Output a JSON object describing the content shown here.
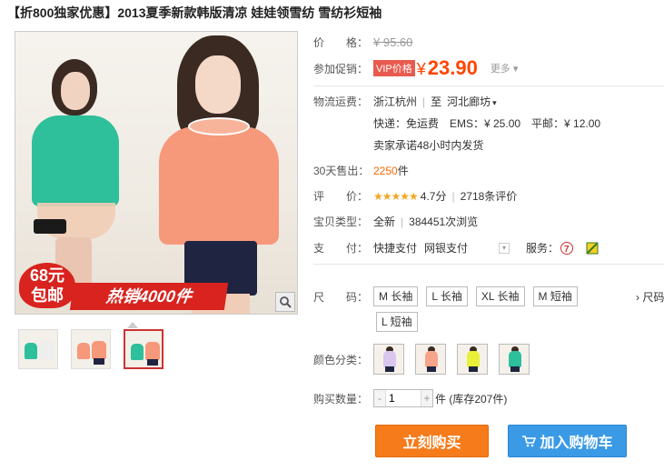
{
  "title": "【折800独家优惠】2013夏季新款韩版清凉 娃娃领雪纺 雪纺衫短袖",
  "image": {
    "badge_line1": "68元",
    "badge_line2": "包邮",
    "banner": "热销4000件",
    "zoom_icon": "magnifier-icon"
  },
  "price": {
    "label": "价　　格：",
    "original": "¥ 95.60"
  },
  "promo": {
    "label": "参加促销：",
    "tag": "VIP价格",
    "yen": "¥",
    "amount": "23.90",
    "more": "更多 ▾"
  },
  "shipping": {
    "label": "物流运费：",
    "from": "浙江杭州",
    "to_prefix": "至",
    "to": "河北廊坊",
    "line2": "快递：免运费　EMS：¥ 25.00　平邮：¥ 12.00",
    "line3": "卖家承诺48小时内发货"
  },
  "sales": {
    "label": "30天售出：",
    "count": "2250",
    "unit": "件"
  },
  "rating": {
    "label": "评　　价：",
    "stars": "★★★★★",
    "score": "4.7分",
    "reviews": "2718条评价"
  },
  "condition": {
    "label": "宝贝类型：",
    "value": "全新",
    "views": "384451次浏览"
  },
  "payment": {
    "label": "支　　付：",
    "method1": "快捷支付",
    "method2": "网银支付",
    "service_label": "服务："
  },
  "sizes": {
    "label": "尺　　码：",
    "options": [
      "M 长袖",
      "L 长袖",
      "XL 长袖",
      "M 短袖",
      "L 短袖"
    ],
    "more": "› 尺码"
  },
  "colors": {
    "label": "颜色分类：",
    "swatches": [
      "#d9c7ef",
      "#f6a58a",
      "#e9f03a",
      "#2ebf9b"
    ]
  },
  "quantity": {
    "label": "购买数量：",
    "minus": "-",
    "value": "1",
    "plus": "+",
    "stock": "件 (库存207件)"
  },
  "buttons": {
    "buy": "立刻购买",
    "cart": "加入购物车"
  }
}
